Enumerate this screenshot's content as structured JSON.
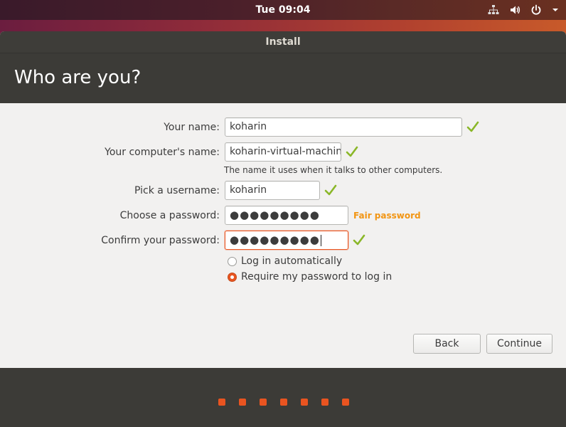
{
  "topbar": {
    "clock": "Tue 09:04",
    "icons": [
      "network-icon",
      "volume-icon",
      "power-icon",
      "menu-arrow-icon"
    ]
  },
  "window": {
    "title": "Install",
    "heading": "Who are you?"
  },
  "form": {
    "name_label": "Your name:",
    "name_value": "koharin",
    "computer_label": "Your computer's name:",
    "computer_value": "koharin-virtual-machin",
    "computer_hint": "The name it uses when it talks to other computers.",
    "username_label": "Pick a username:",
    "username_value": "koharin",
    "password_label": "Choose a password:",
    "password_value": "●●●●●●●●●",
    "password_strength": "Fair password",
    "confirm_label": "Confirm your password:",
    "confirm_value": "●●●●●●●●●",
    "login_auto_label": "Log in automatically",
    "login_password_label": "Require my password to log in",
    "selected_login_option": "Require my password to log in"
  },
  "buttons": {
    "back": "Back",
    "continue": "Continue"
  },
  "progress": {
    "steps": 7
  },
  "colors": {
    "accent": "#e95420",
    "check": "#8ab728",
    "strength": "#f29513",
    "dark_panel": "#3c3b37"
  }
}
